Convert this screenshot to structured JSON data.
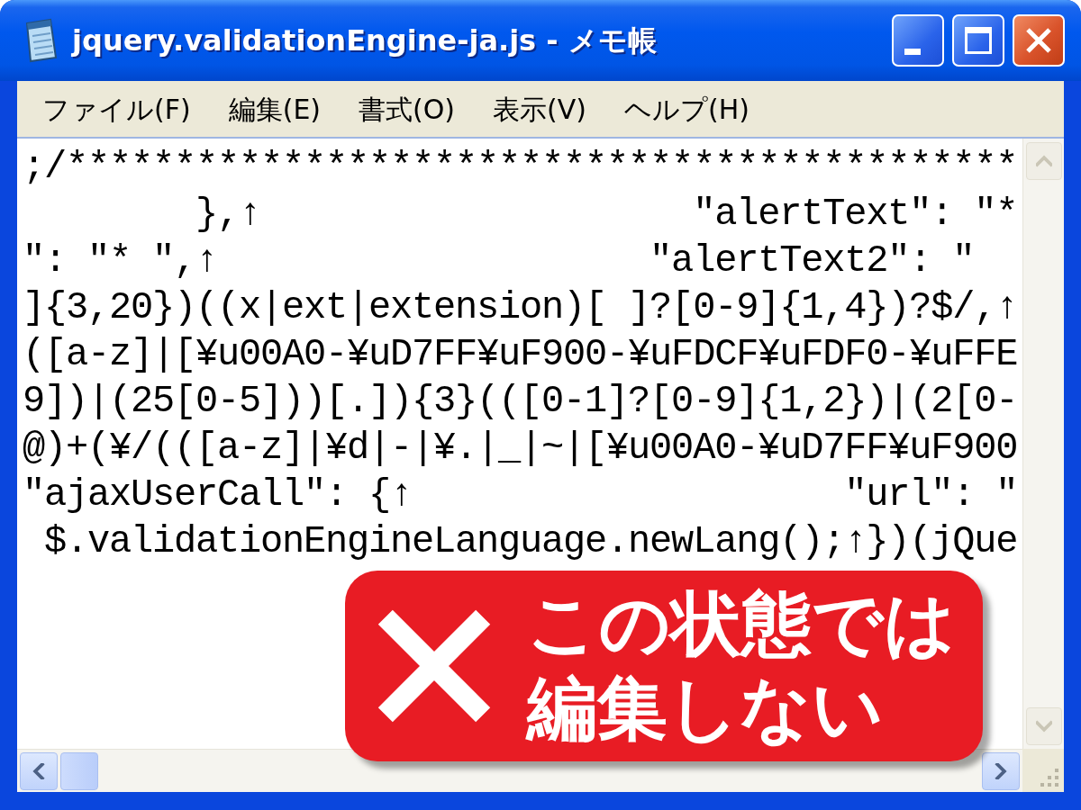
{
  "window": {
    "title": "jquery.validationEngine-ja.js - メモ帳"
  },
  "menu": [
    "ファイル(F)",
    "編集(E)",
    "書式(O)",
    "表示(V)",
    "ヘルプ(H)"
  ],
  "editor": {
    "lines": [
      ";/********************************************",
      "        },↑                    \"alertText\": \"*",
      "\": \"* \",↑                    \"alertText2\": \"",
      "]{3,20})((x|ext|extension)[ ]?[0-9]{1,4})?$/,↑",
      "([a-z]|[¥u00A0-¥uD7FF¥uF900-¥uFDCF¥uFDF0-¥uFFE",
      "9])|(25[0-5]))[.]){3}(([0-1]?[0-9]{1,2})|(2[0-",
      "@)+(¥/(([a-z]|¥d|-|¥.|_|~|[¥u00A0-¥uD7FF¥uF900",
      "\"ajaxUserCall\": {↑                    \"url\": \"",
      " $.validationEngineLanguage.newLang();↑})(jQue"
    ]
  },
  "overlay": {
    "lines": [
      "この状態では",
      "編集しない"
    ]
  }
}
